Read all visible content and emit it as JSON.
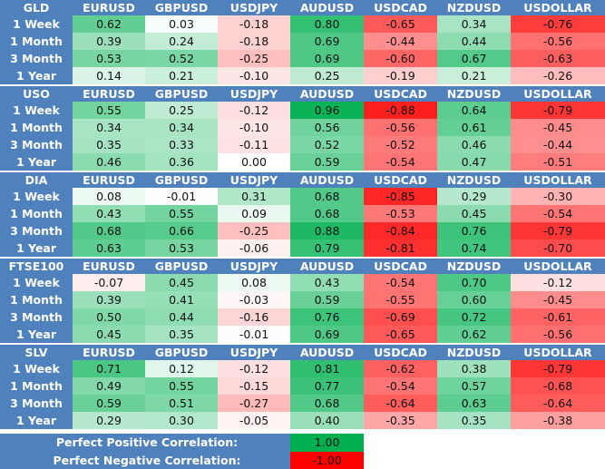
{
  "columns": [
    "EURUSD",
    "GBPUSD",
    "USDJPY",
    "AUDUSD",
    "USDCAD",
    "NZDUSD",
    "USDOLLAR"
  ],
  "colors": {
    "header_bg": "#4F81BD",
    "header_text": "#FFFFFF",
    "positive_max": "#00B050",
    "negative_max": "#FF0000",
    "neutral": "#FFFFFF"
  },
  "sections": [
    {
      "asset": "GLD",
      "rows": [
        {
          "period": "1 Week",
          "values": [
            "0.62",
            "0.03",
            "-0.18",
            "0.80",
            "-0.65",
            "0.34",
            "-0.76"
          ]
        },
        {
          "period": "1 Month",
          "values": [
            "0.39",
            "0.24",
            "-0.18",
            "0.69",
            "-0.44",
            "0.44",
            "-0.56"
          ]
        },
        {
          "period": "3 Month",
          "values": [
            "0.53",
            "0.52",
            "-0.25",
            "0.69",
            "-0.60",
            "0.67",
            "-0.63"
          ]
        },
        {
          "period": "1 Year",
          "values": [
            "0.14",
            "0.21",
            "-0.10",
            "0.25",
            "-0.19",
            "0.21",
            "-0.26"
          ]
        }
      ]
    },
    {
      "asset": "USO",
      "rows": [
        {
          "period": "1 Week",
          "values": [
            "0.55",
            "0.25",
            "-0.12",
            "0.96",
            "-0.88",
            "0.64",
            "-0.79"
          ]
        },
        {
          "period": "1 Month",
          "values": [
            "0.34",
            "0.34",
            "-0.10",
            "0.56",
            "-0.56",
            "0.61",
            "-0.45"
          ]
        },
        {
          "period": "3 Month",
          "values": [
            "0.35",
            "0.33",
            "-0.11",
            "0.52",
            "-0.52",
            "0.46",
            "-0.44"
          ]
        },
        {
          "period": "1 Year",
          "values": [
            "0.46",
            "0.36",
            "0.00",
            "0.59",
            "-0.54",
            "0.47",
            "-0.51"
          ]
        }
      ]
    },
    {
      "asset": "DIA",
      "rows": [
        {
          "period": "1 Week",
          "values": [
            "0.08",
            "-0.01",
            "0.31",
            "0.68",
            "-0.85",
            "0.29",
            "-0.30"
          ]
        },
        {
          "period": "1 Month",
          "values": [
            "0.43",
            "0.55",
            "0.09",
            "0.68",
            "-0.53",
            "0.45",
            "-0.54"
          ]
        },
        {
          "period": "3 Month",
          "values": [
            "0.68",
            "0.66",
            "-0.25",
            "0.88",
            "-0.84",
            "0.76",
            "-0.79"
          ]
        },
        {
          "period": "1 Year",
          "values": [
            "0.63",
            "0.53",
            "-0.06",
            "0.79",
            "-0.81",
            "0.74",
            "-0.70"
          ]
        }
      ]
    },
    {
      "asset": "FTSE100",
      "rows": [
        {
          "period": "1 Week",
          "values": [
            "-0.07",
            "0.45",
            "0.08",
            "0.43",
            "-0.54",
            "0.70",
            "-0.12"
          ]
        },
        {
          "period": "1 Month",
          "values": [
            "0.39",
            "0.41",
            "-0.03",
            "0.59",
            "-0.55",
            "0.60",
            "-0.45"
          ]
        },
        {
          "period": "3 Month",
          "values": [
            "0.50",
            "0.44",
            "-0.16",
            "0.76",
            "-0.69",
            "0.72",
            "-0.61"
          ]
        },
        {
          "period": "1 Year",
          "values": [
            "0.45",
            "0.35",
            "-0.01",
            "0.69",
            "-0.65",
            "0.62",
            "-0.56"
          ]
        }
      ]
    },
    {
      "asset": "SLV",
      "rows": [
        {
          "period": "1 Week",
          "values": [
            "0.71",
            "0.12",
            "-0.12",
            "0.81",
            "-0.62",
            "0.38",
            "-0.79"
          ]
        },
        {
          "period": "1 Month",
          "values": [
            "0.49",
            "0.55",
            "-0.15",
            "0.77",
            "-0.54",
            "0.57",
            "-0.68"
          ]
        },
        {
          "period": "3 Month",
          "values": [
            "0.59",
            "0.51",
            "-0.27",
            "0.68",
            "-0.64",
            "0.63",
            "-0.64"
          ]
        },
        {
          "period": "1 Year",
          "values": [
            "0.29",
            "0.30",
            "-0.05",
            "0.40",
            "-0.35",
            "0.35",
            "-0.38"
          ]
        }
      ]
    }
  ],
  "legend": [
    {
      "label": "Perfect Positive Correlation:",
      "value": "1.00"
    },
    {
      "label": "Perfect Negative Correlation:",
      "value": "-1.00"
    }
  ]
}
